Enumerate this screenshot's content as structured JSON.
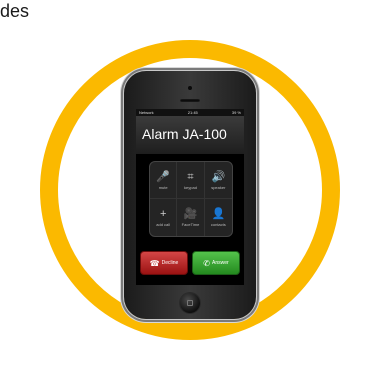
{
  "partial_text": "des",
  "phone": {
    "status": {
      "carrier": "Network",
      "time": "21:45",
      "battery": "39 %"
    },
    "caller_name": "Alarm JA-100",
    "keypad": [
      {
        "label": "mute",
        "icon": "mic-off-icon",
        "glyph": "🎤"
      },
      {
        "label": "keypad",
        "icon": "keypad-icon",
        "glyph": "⌗"
      },
      {
        "label": "speaker",
        "icon": "speaker-icon",
        "glyph": "🔊"
      },
      {
        "label": "add call",
        "icon": "add-icon",
        "glyph": "+"
      },
      {
        "label": "FaceTime",
        "icon": "video-icon",
        "glyph": "🎥"
      },
      {
        "label": "contacts",
        "icon": "contact-icon",
        "glyph": "👤"
      }
    ],
    "buttons": {
      "decline": "Decline",
      "answer": "Answer"
    }
  },
  "colors": {
    "ring": "#fbb900",
    "decline": "#c62828",
    "answer": "#3bb143"
  }
}
